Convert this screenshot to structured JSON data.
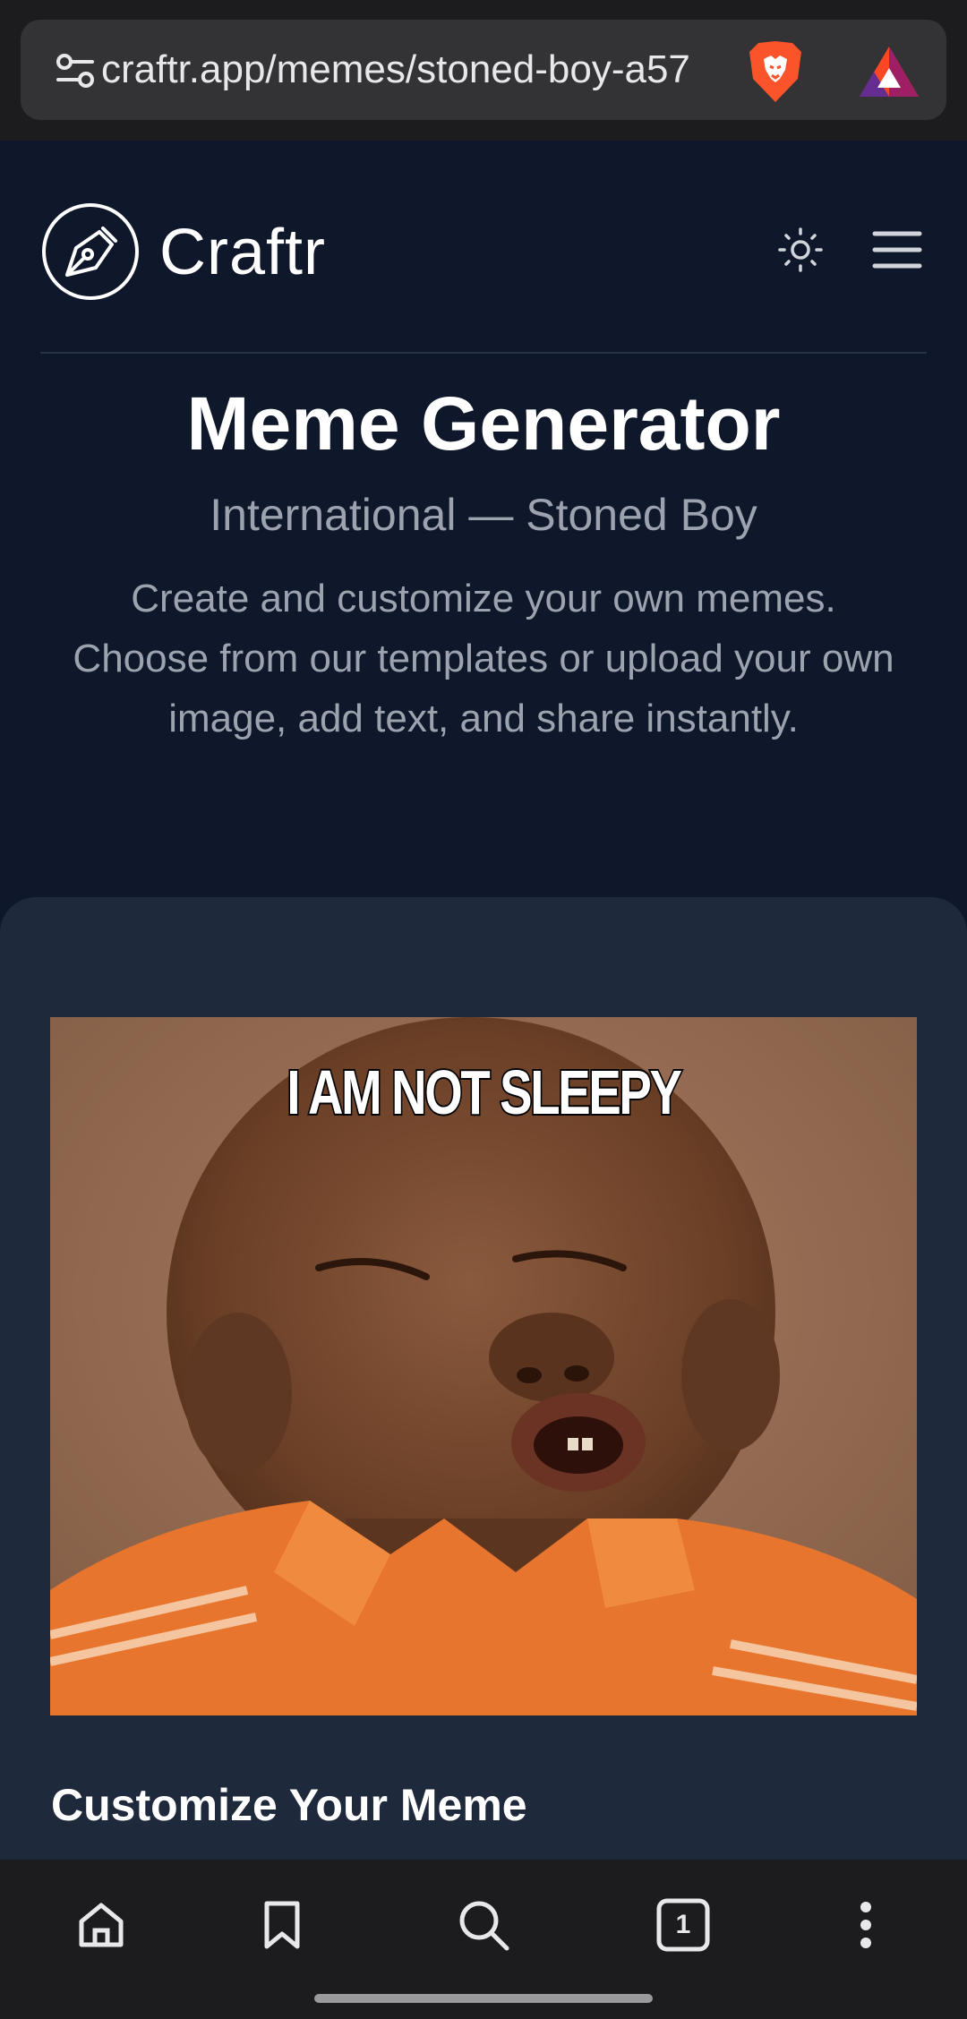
{
  "browser": {
    "url": "craftr.app/memes/stoned-boy-a57",
    "icons": {
      "settings": "site-settings-icon",
      "shield": "brave-shield-icon",
      "rewards": "bat-rewards-icon"
    }
  },
  "header": {
    "logo_text": "Craftr",
    "icons": {
      "logo": "pen-nib-icon",
      "theme": "sun-icon",
      "menu": "hamburger-menu-icon"
    }
  },
  "hero": {
    "title": "Meme Generator",
    "subtitle": "International — Stoned Boy",
    "description": "Create and customize your own memes. Choose from our templates or upload your own image, add text, and share instantly."
  },
  "meme": {
    "top_text": "I AM NOT SLEEPY"
  },
  "customize": {
    "title": "Customize Your Meme"
  },
  "bottom_nav": {
    "tab_count": "1",
    "icons": [
      "home-icon",
      "bookmark-icon",
      "search-icon",
      "tabs-icon",
      "more-icon"
    ]
  },
  "colors": {
    "page_bg": "#0f172a",
    "card_bg": "#1e293b",
    "muted_text": "#9ca3af",
    "brave_orange": "#fb542b",
    "shirt_orange": "#e8752e"
  }
}
